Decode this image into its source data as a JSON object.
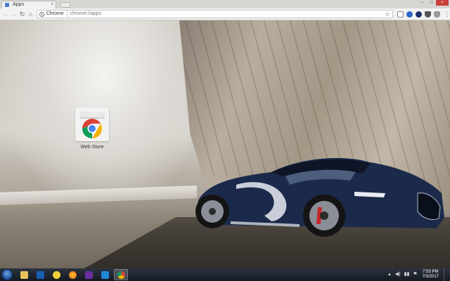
{
  "browser": {
    "tab": {
      "title": "Apps",
      "close_glyph": "×"
    },
    "window_controls": {
      "minimize": "–",
      "maximize": "□",
      "close": "×"
    },
    "omnibox": {
      "chip": "Chrome",
      "url": "chrome://apps"
    }
  },
  "apps": [
    {
      "label": "Web Store",
      "icon": "chrome-web-store-icon"
    }
  ],
  "taskbar": {
    "clock_time": "7:53 PM",
    "clock_date": "7/3/2017",
    "icons": [
      "start-orb",
      "file-explorer-icon",
      "outlook-icon",
      "sticky-notes-icon",
      "firefox-icon",
      "visual-studio-icon",
      "vscode-icon",
      "chrome-icon"
    ]
  },
  "colors": {
    "chrome_red": "#db4437",
    "chrome_green": "#0f9d58",
    "chrome_yellow": "#f4b400",
    "chrome_blue": "#4285f4",
    "taskbar": "#1c222c"
  }
}
